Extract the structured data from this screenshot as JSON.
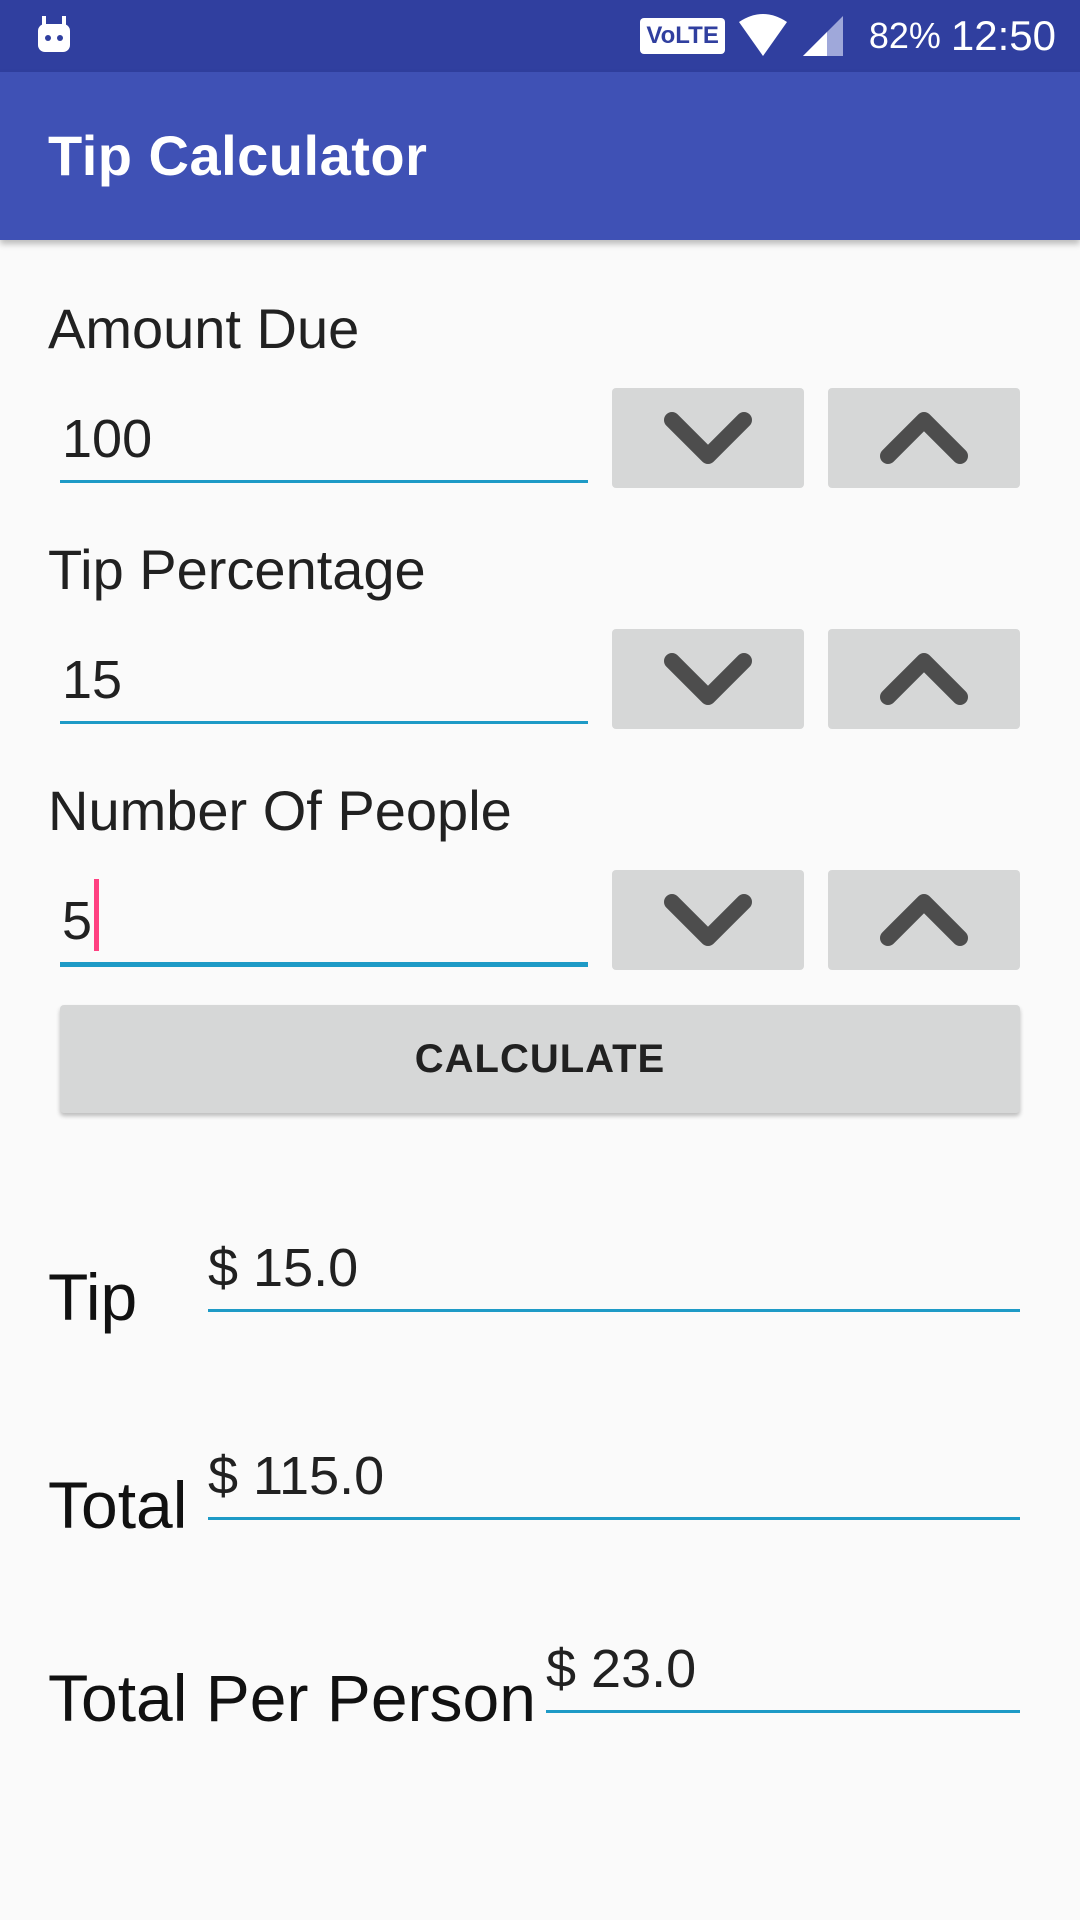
{
  "status_bar": {
    "notification_icon": "android-debug-icon",
    "network_badge": "VoLTE",
    "battery": "82%",
    "time": "12:50",
    "background_color": "#303f9f"
  },
  "app_bar": {
    "title": "Tip Calculator",
    "color": "#3f51b5"
  },
  "form": {
    "amount_due": {
      "label": "Amount Due",
      "value": "100"
    },
    "tip_percentage": {
      "label": "Tip Percentage",
      "value": "15"
    },
    "number_of_people": {
      "label": "Number Of People",
      "value": "5"
    },
    "calculate_label": "CALCULATE"
  },
  "results": {
    "tip": {
      "label": "Tip",
      "value": "$ 15.0"
    },
    "total": {
      "label": "Total",
      "value": "$ 115.0"
    },
    "per_person": {
      "label": "Total Per Person",
      "value": "$ 23.0"
    }
  },
  "colors": {
    "accent": "#1e9ac6",
    "caret": "#ff4081",
    "button_bg": "#d6d7d7"
  }
}
